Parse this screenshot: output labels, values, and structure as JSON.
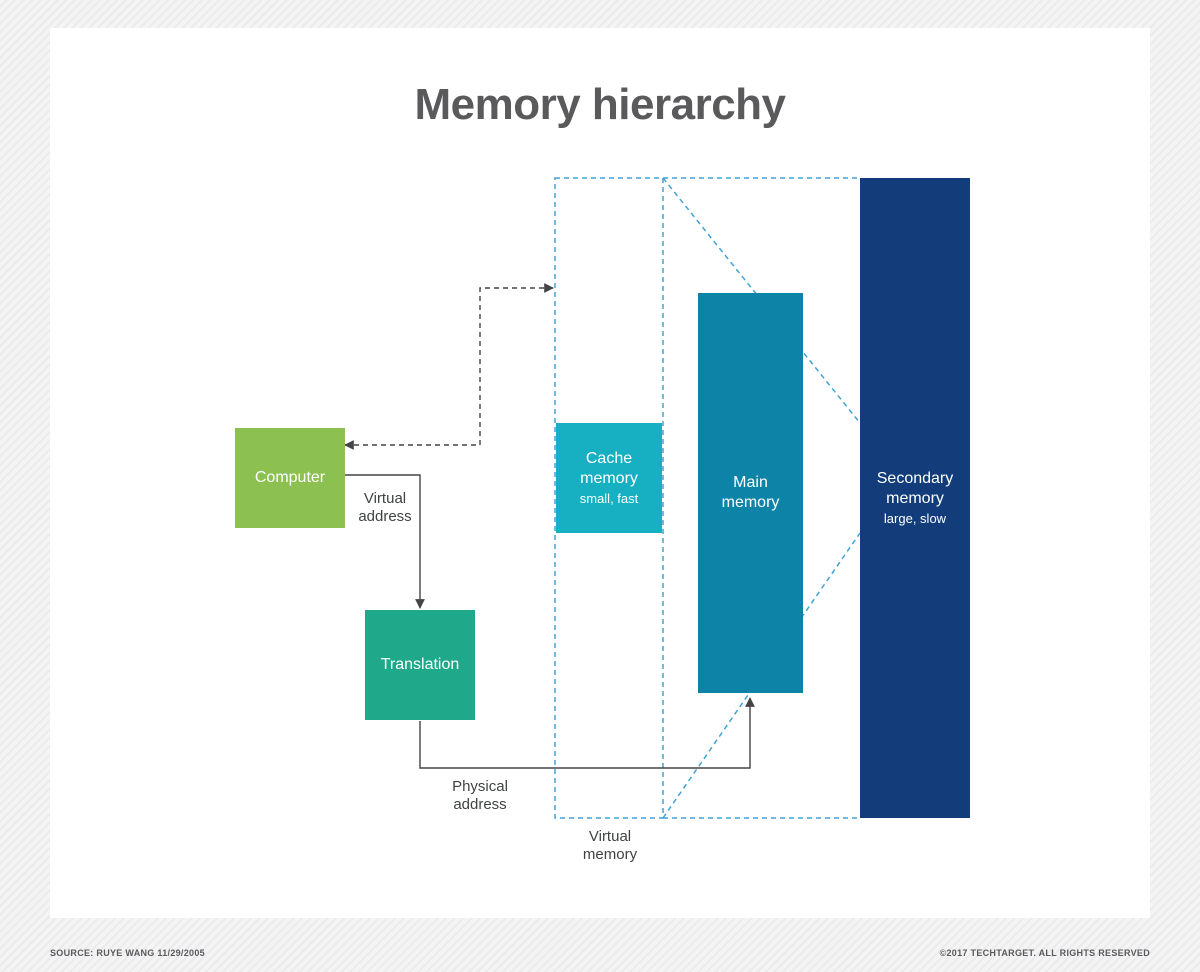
{
  "title": "Memory hierarchy",
  "nodes": {
    "computer": {
      "label": "Computer"
    },
    "translation": {
      "label": "Translation"
    },
    "cache": {
      "label1": "Cache",
      "label2": "memory",
      "sub": "small, fast"
    },
    "mainmem": {
      "label1": "Main",
      "label2": "memory"
    },
    "secondary": {
      "label1": "Secondary",
      "label2": "memory",
      "sub": "large, slow"
    },
    "virtualmem": {
      "label1": "Virtual",
      "label2": "memory"
    }
  },
  "labels": {
    "virtual_address": {
      "l1": "Virtual",
      "l2": "address"
    },
    "physical_address": {
      "l1": "Physical",
      "l2": "address"
    }
  },
  "colors": {
    "computer": "#8cc152",
    "translation": "#1fa98a",
    "cache": "#16b0c2",
    "mainmem": "#0e83a8",
    "secondary": "#123d7a",
    "dashed": "#3fa3d6",
    "arrow": "#444444"
  },
  "footer": {
    "source": "SOURCE: RUYE WANG 11/29/2005",
    "copyright": "©2017 TECHTARGET. ALL RIGHTS RESERVED"
  }
}
